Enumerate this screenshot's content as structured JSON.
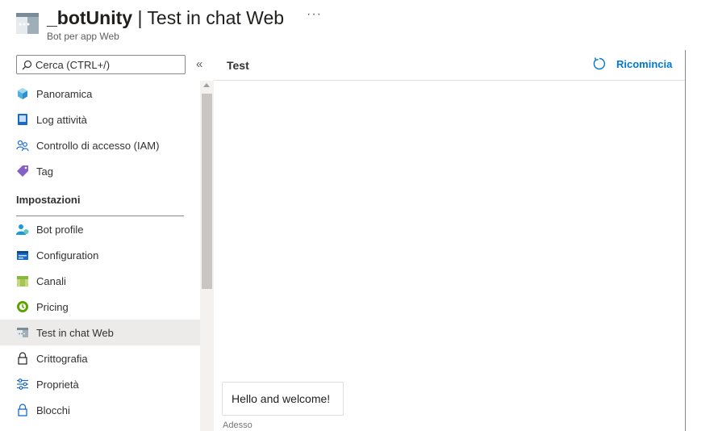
{
  "header": {
    "resource_name": "_botUnity",
    "separator": "|",
    "page_title": "Test in chat Web",
    "subtitle": "Bot per app Web",
    "more_label": "···"
  },
  "sidebar": {
    "search_placeholder": "Cerca (CTRL+/)",
    "collapse_label": "«",
    "items_top": [
      {
        "label": "Panoramica",
        "icon": "cube-icon"
      },
      {
        "label": "Log attività",
        "icon": "activity-log-icon"
      },
      {
        "label": "Controllo di accesso (IAM)",
        "icon": "people-icon"
      },
      {
        "label": "Tag",
        "icon": "tag-icon"
      }
    ],
    "section_title": "Impostazioni",
    "items_settings": [
      {
        "label": "Bot profile",
        "icon": "bot-profile-icon"
      },
      {
        "label": "Configuration",
        "icon": "configuration-icon"
      },
      {
        "label": "Canali",
        "icon": "channels-icon"
      },
      {
        "label": "Pricing",
        "icon": "pricing-icon"
      },
      {
        "label": "Test in chat Web",
        "icon": "webchat-icon",
        "active": true
      },
      {
        "label": "Crittografia",
        "icon": "lock-icon"
      },
      {
        "label": "Proprietà",
        "icon": "properties-icon"
      },
      {
        "label": "Blocchi",
        "icon": "lock-icon"
      }
    ]
  },
  "main": {
    "title": "Test",
    "restart_label": "Ricomincia",
    "messages": [
      {
        "text": "Hello and welcome!",
        "timestamp": "Adesso"
      }
    ]
  },
  "colors": {
    "accent": "#0078d4",
    "active_bg": "#edebe9",
    "text": "#323130"
  }
}
